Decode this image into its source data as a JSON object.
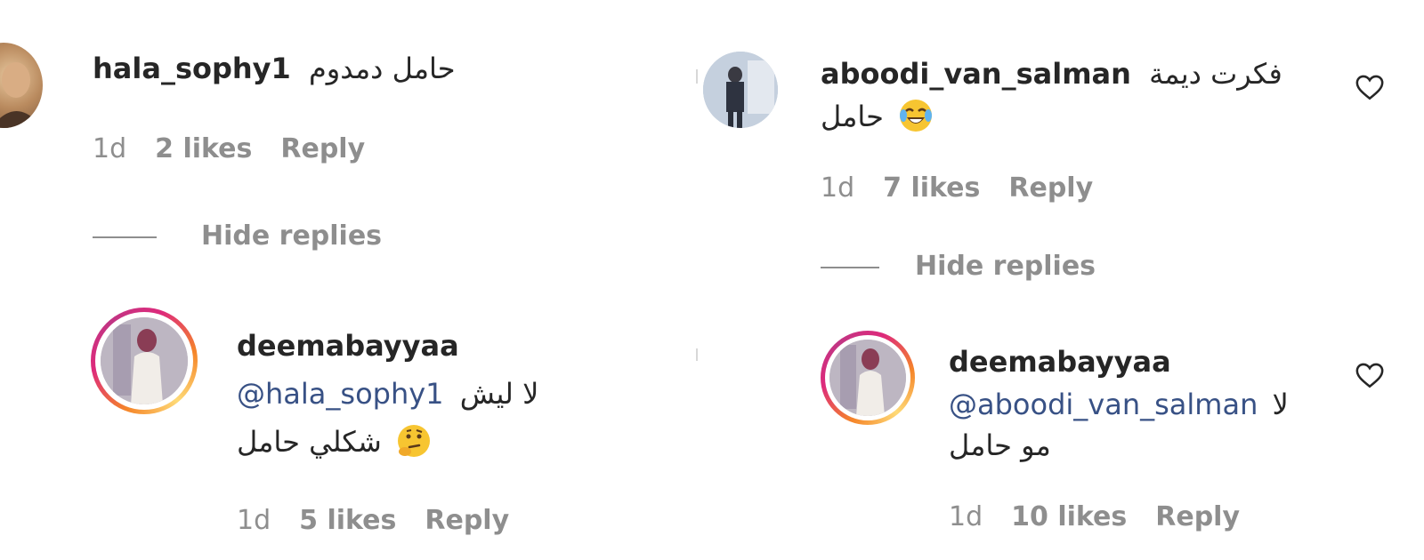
{
  "left": {
    "comment": {
      "username": "hala_sophy1",
      "text": "حامل دمدوم",
      "time": "1d",
      "likes": "2 likes",
      "reply": "Reply"
    },
    "hide_replies": "Hide replies",
    "reply_comment": {
      "username": "deemabayyaa",
      "mention": "@hala_sophy1",
      "line1_text": "لا ليش",
      "line2_text": "شكلي حامل",
      "line2_emoji": "thinking-face-emoji",
      "time": "1d",
      "likes": "5 likes",
      "reply": "Reply"
    }
  },
  "right": {
    "comment": {
      "username": "aboodi_van_salman",
      "line1_text": "فكرت ديمة",
      "line2_text": "حامل",
      "line2_emoji": "tears-of-joy-emoji",
      "time": "1d",
      "likes": "7 likes",
      "reply": "Reply"
    },
    "hide_replies": "Hide replies",
    "reply_comment": {
      "username": "deemabayyaa",
      "mention": "@aboodi_van_salman",
      "line1_text": "لا",
      "line2_text": "مو حامل",
      "time": "1d",
      "likes": "10 likes",
      "reply": "Reply"
    }
  },
  "icons": {
    "like": "heart-outline-icon"
  }
}
